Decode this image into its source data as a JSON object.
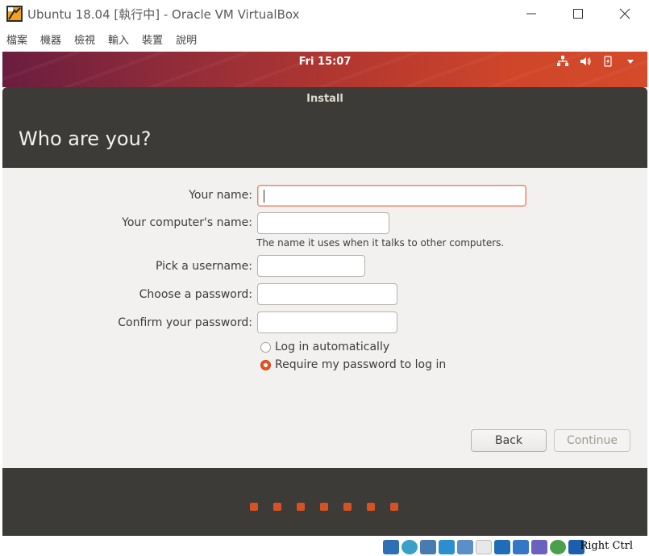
{
  "window": {
    "title": "Ubuntu 18.04 [執行中] - Oracle VM VirtualBox"
  },
  "menu": [
    "檔案",
    "機器",
    "檢視",
    "輸入",
    "裝置",
    "說明"
  ],
  "vm": {
    "clock": "Fri 15:07",
    "install_title": "Install",
    "page_title": "Who are you?",
    "form": {
      "name_label": "Your name:",
      "name_value": "",
      "computer_label": "Your computer's name:",
      "computer_value": "",
      "computer_hint": "The name it uses when it talks to other computers.",
      "username_label": "Pick a username:",
      "username_value": "",
      "password_label": "Choose a password:",
      "password_value": "",
      "confirm_label": "Confirm your password:",
      "confirm_value": "",
      "option_auto": "Log in automatically",
      "option_require": "Require my password to log in",
      "selected_option": "require"
    },
    "buttons": {
      "back": "Back",
      "continue": "Continue"
    },
    "progress_dots": 7
  },
  "statusbar": {
    "host_key": "Right Ctrl"
  },
  "colors": {
    "accent": "#e95420",
    "header": "#3c3b37",
    "background": "#f2f1f0"
  }
}
